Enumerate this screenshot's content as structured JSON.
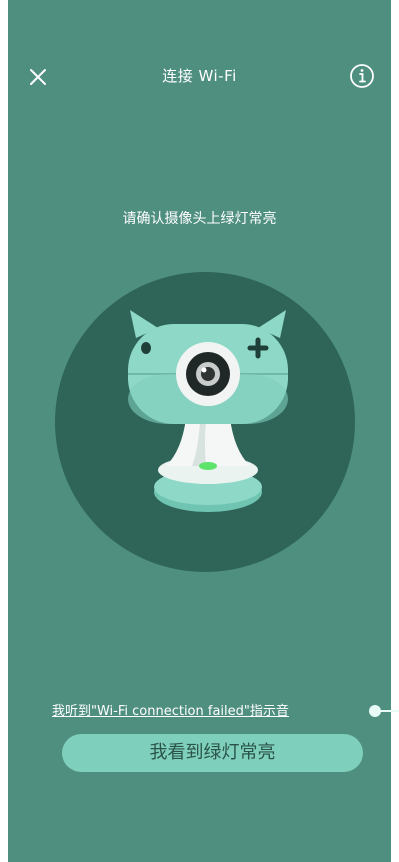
{
  "header": {
    "title": "连接 Wi-Fi",
    "close_icon": "close-icon",
    "info_icon": "info-icon"
  },
  "main": {
    "instruction": "请确认摄像头上绿灯常亮",
    "illustration": "camera-illustration"
  },
  "footer": {
    "fail_link": "我听到\"Wi-Fi connection failed\"指示音",
    "confirm_button": "我看到绿灯常亮"
  },
  "colors": {
    "background": "#4f8f80",
    "circle": "#2e6558",
    "button": "#7fcfbd",
    "button_text": "#2b5449",
    "indicator_light": "#5be36b"
  }
}
